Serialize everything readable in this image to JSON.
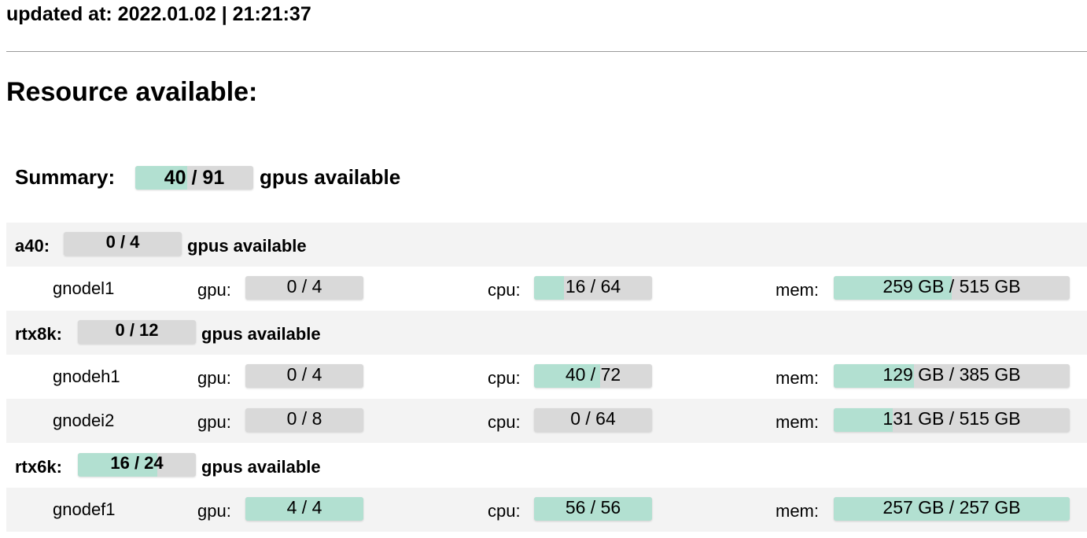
{
  "header": {
    "updated": "updated at: 2022.01.02 | 21:21:37"
  },
  "title": "Resource available:",
  "summary": {
    "label": "Summary:",
    "value": "40 / 91",
    "fraction": 0.44,
    "suffix": "gpus available"
  },
  "labels": {
    "gpu": "gpu:",
    "cpu": "cpu:",
    "mem": "mem:",
    "gpus_available": "gpus available"
  },
  "groups": [
    {
      "name": "a40:",
      "value": "0 / 4",
      "fraction": 0.0,
      "nodes": [
        {
          "name": "gnodel1",
          "gpu": "0 / 4",
          "gpu_frac": 0.0,
          "cpu": "16 / 64",
          "cpu_frac": 0.25,
          "mem": "259 GB / 515 GB",
          "mem_frac": 0.5
        }
      ]
    },
    {
      "name": "rtx8k:",
      "value": "0 / 12",
      "fraction": 0.0,
      "nodes": [
        {
          "name": "gnodeh1",
          "gpu": "0 / 4",
          "gpu_frac": 0.0,
          "cpu": "40 / 72",
          "cpu_frac": 0.56,
          "mem": "129 GB / 385 GB",
          "mem_frac": 0.34
        },
        {
          "name": "gnodei2",
          "gpu": "0 / 8",
          "gpu_frac": 0.0,
          "cpu": "0 / 64",
          "cpu_frac": 0.0,
          "mem": "131 GB / 515 GB",
          "mem_frac": 0.25
        }
      ]
    },
    {
      "name": "rtx6k:",
      "value": "16 / 24",
      "fraction": 0.67,
      "nodes": [
        {
          "name": "gnodef1",
          "gpu": "4 / 4",
          "gpu_frac": 1.0,
          "cpu": "56 / 56",
          "cpu_frac": 1.0,
          "mem": "257 GB / 257 GB",
          "mem_frac": 1.0
        }
      ]
    }
  ]
}
